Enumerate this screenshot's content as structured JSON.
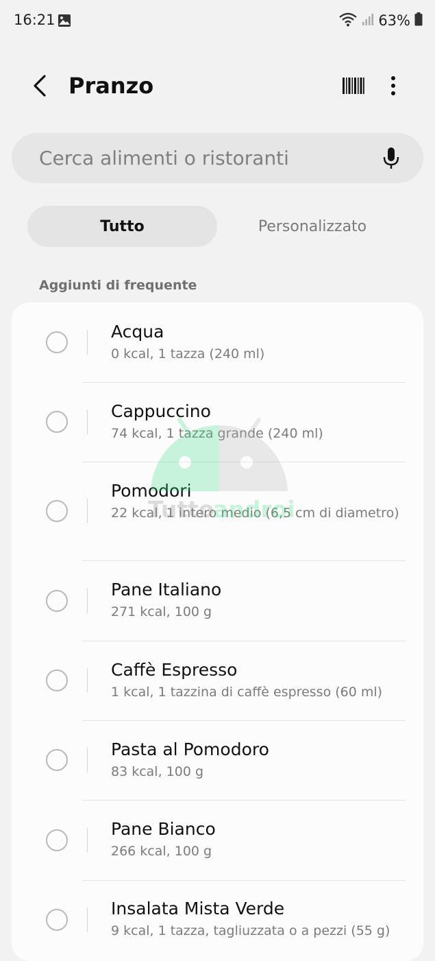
{
  "status_bar": {
    "time": "16:21",
    "battery": "63%",
    "icons": [
      "gallery-icon",
      "wifi-icon",
      "signal-icon",
      "battery-icon"
    ]
  },
  "header": {
    "title": "Pranzo",
    "icons": [
      "back-arrow-icon",
      "barcode-icon",
      "more-vertical-icon"
    ]
  },
  "search": {
    "placeholder": "Cerca alimenti o ristoranti",
    "value": "",
    "icon": "microphone-icon"
  },
  "tabs": {
    "all": "Tutto",
    "custom": "Personalizzato",
    "selected": "Tutto"
  },
  "section": {
    "title": "Aggiunti di frequente"
  },
  "items": [
    {
      "name": "Acqua",
      "desc": "0 kcal, 1 tazza (240 ml)"
    },
    {
      "name": "Cappuccino",
      "desc": "74 kcal, 1 tazza grande (240 ml)"
    },
    {
      "name": "Pomodori",
      "desc": "22 kcal, 1 intero medio (6,5 cm di diametro)"
    },
    {
      "name": "Pane Italiano",
      "desc": "271 kcal, 100 g"
    },
    {
      "name": "Caffè Espresso",
      "desc": "1 kcal, 1 tazzina di caffè espresso (60 ml)"
    },
    {
      "name": "Pasta al Pomodoro",
      "desc": "83 kcal, 100 g"
    },
    {
      "name": "Pane Bianco",
      "desc": "266 kcal, 100 g"
    },
    {
      "name": "Insalata Mista Verde",
      "desc": "9 kcal, 1 tazza, tagliuzzata o a pezzi (55 g)"
    }
  ],
  "watermark": {
    "text": "Tuttoandroid"
  },
  "colors": {
    "background": "#f2f2f2",
    "card": "#fcfcfc",
    "search_bg": "#e6e6e6",
    "tab_selected_bg": "#e4e4e4",
    "secondary_text": "#7b7b7b",
    "watermark_green": "#3ddc84"
  }
}
